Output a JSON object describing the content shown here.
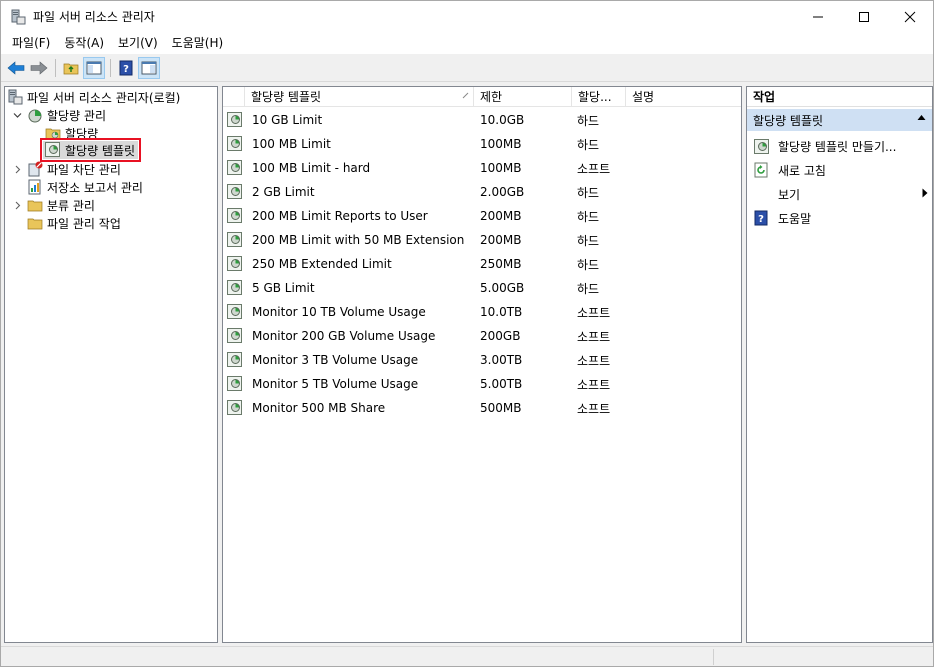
{
  "window": {
    "title": "파일 서버 리소스 관리자"
  },
  "menu": [
    "파일(F)",
    "동작(A)",
    "보기(V)",
    "도움말(H)"
  ],
  "tree": {
    "root": "파일 서버 리소스 관리자(로컬)",
    "quota_mgmt": "할당량 관리",
    "quotas": "할당량",
    "quota_templates": "할당량 템플릿",
    "file_screen": "파일 차단 관리",
    "storage_reports": "저장소 보고서 관리",
    "classification": "분류 관리",
    "file_mgmt_tasks": "파일 관리 작업"
  },
  "list": {
    "columns": [
      "할당량 템플릿",
      "제한",
      "할당...",
      "설명"
    ],
    "rows": [
      {
        "name": "10 GB Limit",
        "limit": "10.0GB",
        "type": "하드",
        "desc": ""
      },
      {
        "name": "100 MB Limit",
        "limit": "100MB",
        "type": "하드",
        "desc": ""
      },
      {
        "name": "100 MB Limit - hard",
        "limit": "100MB",
        "type": "소프트",
        "desc": ""
      },
      {
        "name": "2 GB Limit",
        "limit": "2.00GB",
        "type": "하드",
        "desc": ""
      },
      {
        "name": "200 MB Limit Reports to User",
        "limit": "200MB",
        "type": "하드",
        "desc": ""
      },
      {
        "name": "200 MB Limit with 50 MB Extension",
        "limit": "200MB",
        "type": "하드",
        "desc": ""
      },
      {
        "name": "250 MB Extended Limit",
        "limit": "250MB",
        "type": "하드",
        "desc": ""
      },
      {
        "name": "5 GB Limit",
        "limit": "5.00GB",
        "type": "하드",
        "desc": ""
      },
      {
        "name": "Monitor 10 TB Volume Usage",
        "limit": "10.0TB",
        "type": "소프트",
        "desc": ""
      },
      {
        "name": "Monitor 200 GB Volume Usage",
        "limit": "200GB",
        "type": "소프트",
        "desc": ""
      },
      {
        "name": "Monitor 3 TB Volume Usage",
        "limit": "3.00TB",
        "type": "소프트",
        "desc": ""
      },
      {
        "name": "Monitor 5 TB Volume Usage",
        "limit": "5.00TB",
        "type": "소프트",
        "desc": ""
      },
      {
        "name": "Monitor 500 MB Share",
        "limit": "500MB",
        "type": "소프트",
        "desc": ""
      }
    ]
  },
  "actions": {
    "title": "작업",
    "section": "할당량 템플릿",
    "items": [
      {
        "label": "할당량 템플릿 만들기...",
        "icon": "create-template-icon"
      },
      {
        "label": "새로 고침",
        "icon": "refresh-icon"
      },
      {
        "label": "보기",
        "icon": ""
      },
      {
        "label": "도움말",
        "icon": "help-icon"
      }
    ]
  },
  "colors": {
    "selection_outline": "#e81123",
    "section_header": "#cfe0f3",
    "back_arrow": "#1e7fd6"
  }
}
